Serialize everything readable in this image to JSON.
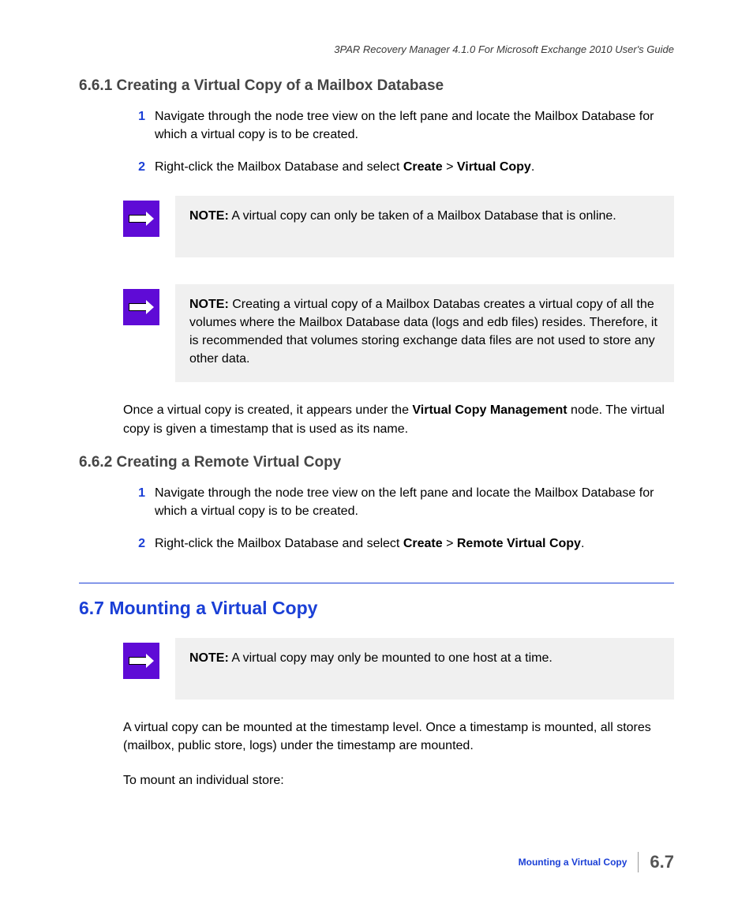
{
  "header": "3PAR Recovery Manager 4.1.0 For Microsoft Exchange 2010 User's Guide",
  "s661": {
    "title": "6.6.1 Creating a Virtual Copy of a Mailbox Database",
    "steps": [
      {
        "n": "1",
        "text_a": "Navigate through the node tree view on the left pane and locate the Mailbox Database for which a virtual copy is to be created."
      },
      {
        "n": "2",
        "text_a": "Right-click the Mailbox Database and select ",
        "b1": "Create",
        "mid": " > ",
        "b2": "Virtual Copy",
        "tail": "."
      }
    ],
    "note1": {
      "label": "NOTE:",
      "text": " A virtual copy can only be taken of a Mailbox Database that is online."
    },
    "note2": {
      "label": "NOTE:",
      "text": " Creating a virtual copy of a Mailbox Databas creates a virtual copy of all the volumes where the Mailbox Database data (logs and edb files) resides. Therefore, it is recommended that volumes storing exchange data files are not used to store any other data."
    },
    "after": {
      "pre": "Once a virtual copy is created, it appears under the ",
      "b": "Virtual Copy Management",
      "post": " node. The virtual copy is given a timestamp that is used as its name."
    }
  },
  "s662": {
    "title": "6.6.2 Creating a Remote Virtual Copy",
    "steps": [
      {
        "n": "1",
        "text_a": "Navigate through the node tree view on the left pane and locate the Mailbox Database for which a virtual copy is to be created."
      },
      {
        "n": "2",
        "text_a": "Right-click the Mailbox Database and select ",
        "b1": "Create",
        "mid": " > ",
        "b2": "Remote Virtual Copy",
        "tail": "."
      }
    ]
  },
  "s67": {
    "title": "6.7  Mounting a Virtual Copy",
    "note": {
      "label": "NOTE:",
      "text": " A virtual copy may only be mounted to one host at a time."
    },
    "p1": "A virtual copy can be mounted at the timestamp level. Once a timestamp is mounted, all stores (mailbox, public store, logs) under the timestamp are mounted.",
    "p2": "To mount an individual store:"
  },
  "footer": {
    "title": "Mounting a Virtual Copy",
    "page": "6.7"
  }
}
